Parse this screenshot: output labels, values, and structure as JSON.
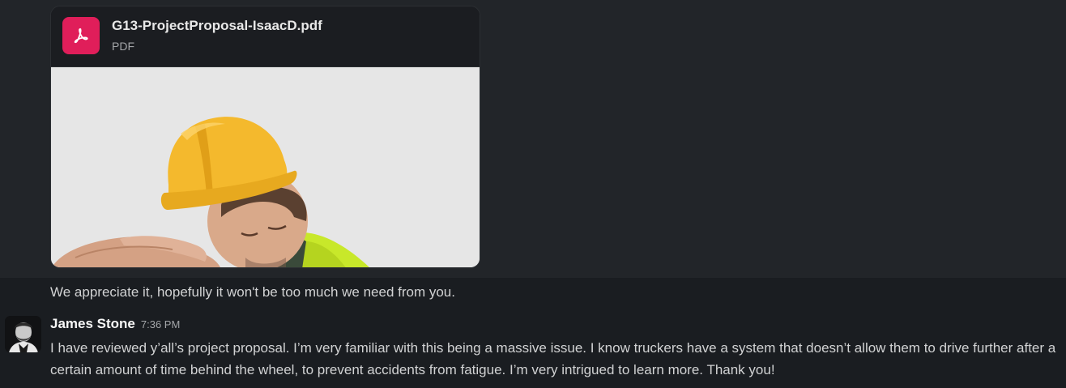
{
  "attachment": {
    "file_name": "G13-ProjectProposal-IsaacD.pdf",
    "file_type": "PDF",
    "icon": "pdf-icon",
    "accent_color": "#e01e5a"
  },
  "previous_message": {
    "text": "We appreciate it, hopefully it won't be too much we need from you."
  },
  "message": {
    "author": "James Stone",
    "time": "7:36 PM",
    "text": "I have reviewed y’all’s project proposal. I’m very familiar with this being a massive issue. I know truckers have a system that doesn’t allow them to drive further after a certain amount of time behind the wheel, to prevent accidents from fatigue. I’m very intrigued to learn more. Thank you!"
  }
}
